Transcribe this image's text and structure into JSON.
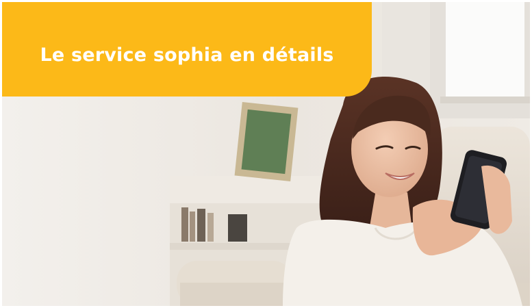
{
  "banner": {
    "title": "Le service sophia en détails",
    "background_color": "#fcb918",
    "text_color": "#ffffff"
  },
  "hero_image": {
    "icon": "woman-smiling-with-smartphone-photo"
  }
}
